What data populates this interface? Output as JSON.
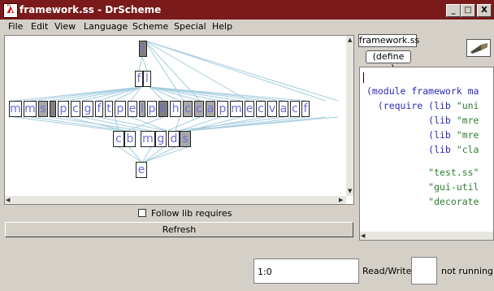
{
  "window": {
    "title": "framework.ss - DrScheme",
    "app_icon": "lambda-icon",
    "controls": [
      "_",
      "□",
      "X"
    ]
  },
  "menu": [
    "File",
    "Edit",
    "View",
    "Language",
    "Scheme",
    "Special",
    "Help"
  ],
  "graph": {
    "row0": [
      "i"
    ],
    "row1": [
      "f",
      "l"
    ],
    "row2": [
      "m",
      "m",
      "s",
      "",
      "p",
      "c",
      "g",
      "f",
      "t",
      "p",
      "e",
      "l",
      "p",
      "k",
      "h",
      "c",
      "c",
      "a",
      "p",
      "m",
      "e",
      "c",
      "v",
      "a",
      "c",
      "f"
    ],
    "row3": [
      "c",
      "b",
      "m",
      "g",
      "d",
      "s"
    ],
    "row4": [
      "e"
    ]
  },
  "controls": {
    "follow_lib_label": "Follow lib requires",
    "follow_lib_checked": false,
    "refresh_label": "Refresh"
  },
  "editor": {
    "file_tab": "framework.ss",
    "define_button": "(define ...)",
    "toolbar_icon": "check-syntax-icon",
    "lines": [
      {
        "code": "(module framework ma",
        "str": ""
      },
      {
        "code": "  (require (lib ",
        "str": "\"uni"
      },
      {
        "code": "           (lib ",
        "str": "\"mre"
      },
      {
        "code": "           (lib ",
        "str": "\"mre"
      },
      {
        "code": "           (lib ",
        "str": "\"cla"
      },
      {
        "code": "",
        "str": ""
      },
      {
        "code": "           ",
        "str": "\"test.ss\""
      },
      {
        "code": "           ",
        "str": "\"gui-util"
      },
      {
        "code": "           ",
        "str": "\"decorate"
      }
    ]
  },
  "status": {
    "position": "1:0",
    "mode": "Read/Write",
    "running": "not running"
  }
}
